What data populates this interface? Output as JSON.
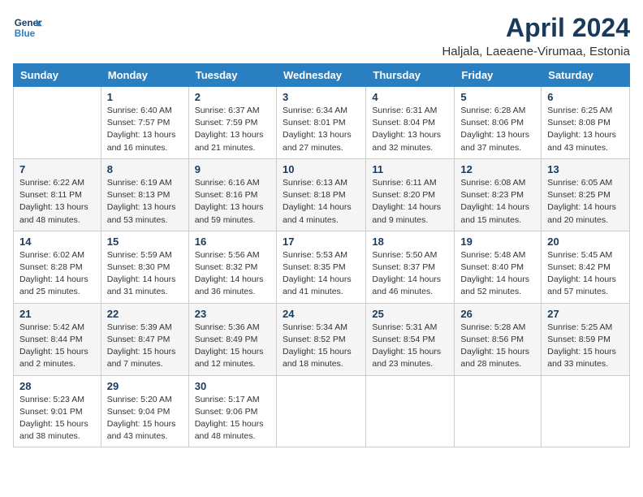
{
  "logo": {
    "line1": "General",
    "line2": "Blue"
  },
  "title": "April 2024",
  "subtitle": "Haljala, Laeaene-Virumaa, Estonia",
  "headers": [
    "Sunday",
    "Monday",
    "Tuesday",
    "Wednesday",
    "Thursday",
    "Friday",
    "Saturday"
  ],
  "weeks": [
    [
      {
        "day": "",
        "info": ""
      },
      {
        "day": "1",
        "info": "Sunrise: 6:40 AM\nSunset: 7:57 PM\nDaylight: 13 hours\nand 16 minutes."
      },
      {
        "day": "2",
        "info": "Sunrise: 6:37 AM\nSunset: 7:59 PM\nDaylight: 13 hours\nand 21 minutes."
      },
      {
        "day": "3",
        "info": "Sunrise: 6:34 AM\nSunset: 8:01 PM\nDaylight: 13 hours\nand 27 minutes."
      },
      {
        "day": "4",
        "info": "Sunrise: 6:31 AM\nSunset: 8:04 PM\nDaylight: 13 hours\nand 32 minutes."
      },
      {
        "day": "5",
        "info": "Sunrise: 6:28 AM\nSunset: 8:06 PM\nDaylight: 13 hours\nand 37 minutes."
      },
      {
        "day": "6",
        "info": "Sunrise: 6:25 AM\nSunset: 8:08 PM\nDaylight: 13 hours\nand 43 minutes."
      }
    ],
    [
      {
        "day": "7",
        "info": "Sunrise: 6:22 AM\nSunset: 8:11 PM\nDaylight: 13 hours\nand 48 minutes."
      },
      {
        "day": "8",
        "info": "Sunrise: 6:19 AM\nSunset: 8:13 PM\nDaylight: 13 hours\nand 53 minutes."
      },
      {
        "day": "9",
        "info": "Sunrise: 6:16 AM\nSunset: 8:16 PM\nDaylight: 13 hours\nand 59 minutes."
      },
      {
        "day": "10",
        "info": "Sunrise: 6:13 AM\nSunset: 8:18 PM\nDaylight: 14 hours\nand 4 minutes."
      },
      {
        "day": "11",
        "info": "Sunrise: 6:11 AM\nSunset: 8:20 PM\nDaylight: 14 hours\nand 9 minutes."
      },
      {
        "day": "12",
        "info": "Sunrise: 6:08 AM\nSunset: 8:23 PM\nDaylight: 14 hours\nand 15 minutes."
      },
      {
        "day": "13",
        "info": "Sunrise: 6:05 AM\nSunset: 8:25 PM\nDaylight: 14 hours\nand 20 minutes."
      }
    ],
    [
      {
        "day": "14",
        "info": "Sunrise: 6:02 AM\nSunset: 8:28 PM\nDaylight: 14 hours\nand 25 minutes."
      },
      {
        "day": "15",
        "info": "Sunrise: 5:59 AM\nSunset: 8:30 PM\nDaylight: 14 hours\nand 31 minutes."
      },
      {
        "day": "16",
        "info": "Sunrise: 5:56 AM\nSunset: 8:32 PM\nDaylight: 14 hours\nand 36 minutes."
      },
      {
        "day": "17",
        "info": "Sunrise: 5:53 AM\nSunset: 8:35 PM\nDaylight: 14 hours\nand 41 minutes."
      },
      {
        "day": "18",
        "info": "Sunrise: 5:50 AM\nSunset: 8:37 PM\nDaylight: 14 hours\nand 46 minutes."
      },
      {
        "day": "19",
        "info": "Sunrise: 5:48 AM\nSunset: 8:40 PM\nDaylight: 14 hours\nand 52 minutes."
      },
      {
        "day": "20",
        "info": "Sunrise: 5:45 AM\nSunset: 8:42 PM\nDaylight: 14 hours\nand 57 minutes."
      }
    ],
    [
      {
        "day": "21",
        "info": "Sunrise: 5:42 AM\nSunset: 8:44 PM\nDaylight: 15 hours\nand 2 minutes."
      },
      {
        "day": "22",
        "info": "Sunrise: 5:39 AM\nSunset: 8:47 PM\nDaylight: 15 hours\nand 7 minutes."
      },
      {
        "day": "23",
        "info": "Sunrise: 5:36 AM\nSunset: 8:49 PM\nDaylight: 15 hours\nand 12 minutes."
      },
      {
        "day": "24",
        "info": "Sunrise: 5:34 AM\nSunset: 8:52 PM\nDaylight: 15 hours\nand 18 minutes."
      },
      {
        "day": "25",
        "info": "Sunrise: 5:31 AM\nSunset: 8:54 PM\nDaylight: 15 hours\nand 23 minutes."
      },
      {
        "day": "26",
        "info": "Sunrise: 5:28 AM\nSunset: 8:56 PM\nDaylight: 15 hours\nand 28 minutes."
      },
      {
        "day": "27",
        "info": "Sunrise: 5:25 AM\nSunset: 8:59 PM\nDaylight: 15 hours\nand 33 minutes."
      }
    ],
    [
      {
        "day": "28",
        "info": "Sunrise: 5:23 AM\nSunset: 9:01 PM\nDaylight: 15 hours\nand 38 minutes."
      },
      {
        "day": "29",
        "info": "Sunrise: 5:20 AM\nSunset: 9:04 PM\nDaylight: 15 hours\nand 43 minutes."
      },
      {
        "day": "30",
        "info": "Sunrise: 5:17 AM\nSunset: 9:06 PM\nDaylight: 15 hours\nand 48 minutes."
      },
      {
        "day": "",
        "info": ""
      },
      {
        "day": "",
        "info": ""
      },
      {
        "day": "",
        "info": ""
      },
      {
        "day": "",
        "info": ""
      }
    ]
  ]
}
